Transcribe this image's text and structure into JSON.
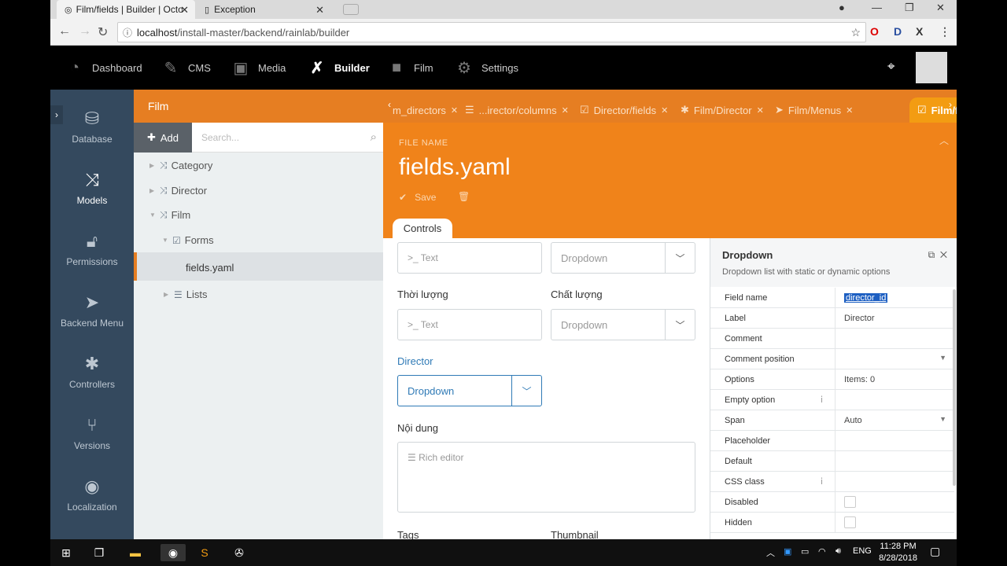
{
  "browser": {
    "tabs": [
      {
        "title": "Film/fields | Builder | Octo"
      },
      {
        "title": "Exception"
      }
    ],
    "url_host": "localhost",
    "url_path": "/install-master/backend/rainlab/builder"
  },
  "topnav": {
    "items": [
      {
        "label": "Dashboard",
        "icon": "dashboard-icon"
      },
      {
        "label": "CMS",
        "icon": "cms-icon"
      },
      {
        "label": "Media",
        "icon": "media-icon"
      },
      {
        "label": "Builder",
        "icon": "builder-icon"
      },
      {
        "label": "Film",
        "icon": "film-icon"
      },
      {
        "label": "Settings",
        "icon": "settings-icon"
      }
    ]
  },
  "sidemenu": {
    "items": [
      {
        "label": "Database"
      },
      {
        "label": "Models"
      },
      {
        "label": "Permissions"
      },
      {
        "label": "Backend Menu"
      },
      {
        "label": "Controllers"
      },
      {
        "label": "Versions"
      },
      {
        "label": "Localization"
      }
    ]
  },
  "tree": {
    "title": "Film",
    "add_label": "Add",
    "search_placeholder": "Search...",
    "items": [
      {
        "label": "Category"
      },
      {
        "label": "Director"
      },
      {
        "label": "Film"
      },
      {
        "label": "Forms"
      },
      {
        "label": "fields.yaml"
      },
      {
        "label": "Lists"
      }
    ]
  },
  "editor_tabs": [
    {
      "label": "m_directors"
    },
    {
      "label": "...irector/columns"
    },
    {
      "label": "Director/fields"
    },
    {
      "label": "Film/Director"
    },
    {
      "label": "Film/Menus"
    },
    {
      "label": "Film/fields"
    }
  ],
  "file": {
    "label": "FILE NAME",
    "name": "fields.yaml",
    "save_label": "Save"
  },
  "form": {
    "tab_label": "Controls",
    "text_placeholder": ">_ Text",
    "dropdown_placeholder": "Dropdown",
    "label_duration": "Thời lượng",
    "label_quality": "Chất lượng",
    "label_director": "Director",
    "label_content": "Nội dung",
    "rich_editor": "Rich editor",
    "label_tags": "Tags",
    "label_thumbnail": "Thumbnail"
  },
  "inspector": {
    "title": "Dropdown",
    "description": "Dropdown list with static or dynamic options",
    "rows": [
      {
        "key": "Field name",
        "value": "director_id"
      },
      {
        "key": "Label",
        "value": "Director"
      },
      {
        "key": "Comment",
        "value": ""
      },
      {
        "key": "Comment position",
        "value": ""
      },
      {
        "key": "Options",
        "value": "Items: 0"
      },
      {
        "key": "Empty option",
        "value": ""
      },
      {
        "key": "Span",
        "value": "Auto"
      },
      {
        "key": "Placeholder",
        "value": ""
      },
      {
        "key": "Default",
        "value": ""
      },
      {
        "key": "CSS class",
        "value": ""
      },
      {
        "key": "Disabled",
        "value": ""
      },
      {
        "key": "Hidden",
        "value": ""
      }
    ]
  },
  "taskbar": {
    "lang": "ENG",
    "time": "11:28 PM",
    "date": "8/28/2018"
  },
  "colors": {
    "orange": "#e67e22",
    "sidebar": "#34495e",
    "selected_blue": "#2f7ab6"
  }
}
